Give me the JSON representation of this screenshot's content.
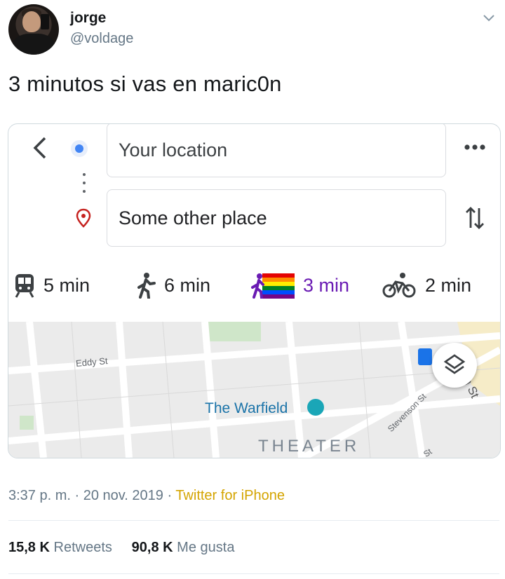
{
  "author": {
    "name": "jorge",
    "handle": "@voldage"
  },
  "tweet": {
    "text": "3 minutos si vas en maric0n"
  },
  "maps": {
    "origin": "Your location",
    "destination": "Some other place",
    "modes": [
      {
        "icon": "train-icon",
        "label": "5 min"
      },
      {
        "icon": "walk-icon",
        "label": "6 min"
      },
      {
        "icon": "rainbow-walk-icon",
        "label": "3 min"
      },
      {
        "icon": "bike-icon",
        "label": "2 min"
      }
    ],
    "map_labels": {
      "street1": "Eddy St",
      "venue": "The Warfield",
      "district": "THEATER",
      "street2": "Stevenson St",
      "street3": "th St",
      "street4": "St"
    },
    "colors": {
      "accent_purple": "#6a1bb3",
      "location_blue": "#4285f4",
      "pin_red": "#c5221f"
    }
  },
  "meta": {
    "time": "3:37 p. m.",
    "sep1": " · ",
    "date": "20 nov. 2019",
    "sep2": " · ",
    "source": "Twitter for iPhone"
  },
  "stats": {
    "retweets_count": "15,8 K",
    "retweets_label": "Retweets",
    "likes_count": "90,8 K",
    "likes_label": "Me gusta"
  }
}
